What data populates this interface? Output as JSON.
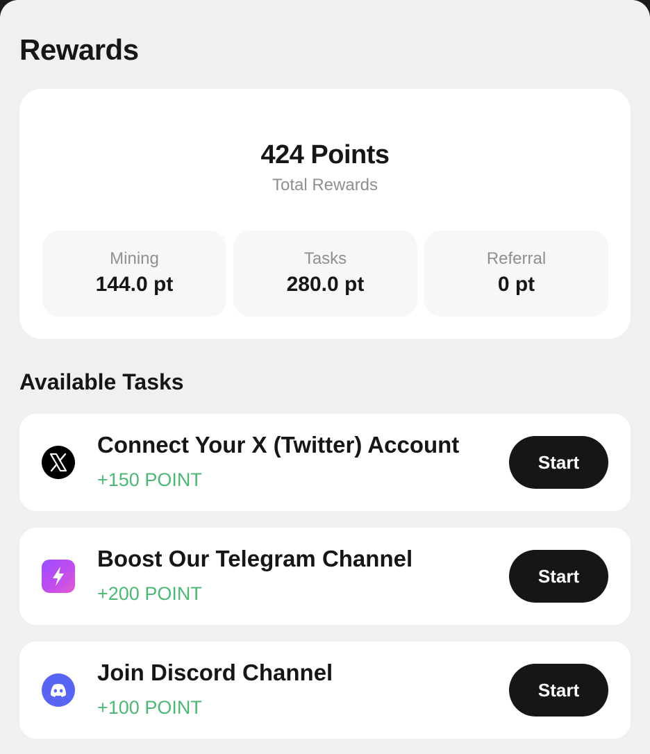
{
  "page": {
    "title": "Rewards"
  },
  "summary": {
    "total_value": "424 Points",
    "total_label": "Total Rewards",
    "stats": [
      {
        "label": "Mining",
        "value": "144.0 pt"
      },
      {
        "label": "Tasks",
        "value": "280.0 pt"
      },
      {
        "label": "Referral",
        "value": "0 pt"
      }
    ]
  },
  "tasks_section": {
    "title": "Available Tasks",
    "items": [
      {
        "icon": "x-twitter-icon",
        "title": "Connect Your X (Twitter) Account",
        "reward": "+150 POINT",
        "button": "Start"
      },
      {
        "icon": "telegram-boost-icon",
        "title": "Boost Our Telegram Channel",
        "reward": "+200 POINT",
        "button": "Start"
      },
      {
        "icon": "discord-icon",
        "title": "Join Discord Channel",
        "reward": "+100 POINT",
        "button": "Start"
      }
    ]
  },
  "colors": {
    "background": "#f0f0f0",
    "card": "#ffffff",
    "stat_box": "#f7f7f7",
    "text": "#161616",
    "muted": "#8f8f8f",
    "reward_green": "#4cb874",
    "button": "#161616",
    "discord": "#5865f2"
  }
}
